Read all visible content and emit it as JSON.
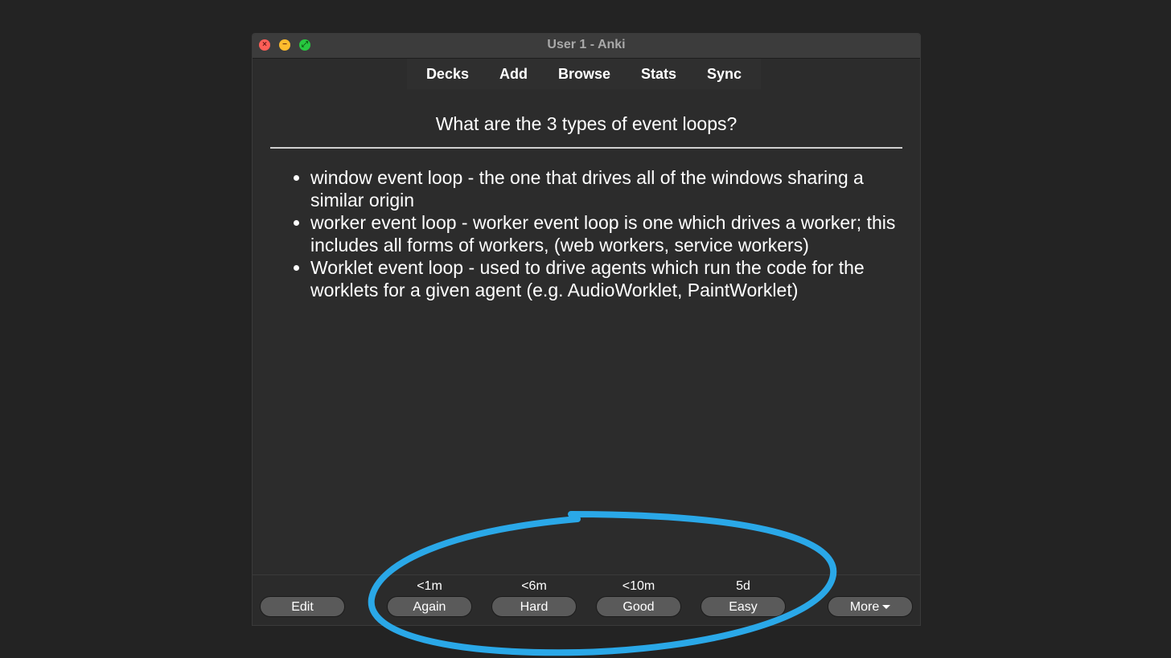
{
  "window": {
    "title": "User 1 - Anki"
  },
  "toolbar": {
    "items": [
      "Decks",
      "Add",
      "Browse",
      "Stats",
      "Sync"
    ]
  },
  "card": {
    "question": "What are the 3 types of event loops?",
    "answers": [
      "window event loop - the one that drives all of the windows sharing a similar origin",
      "worker event loop - worker event loop is one which drives a worker; this includes all forms of workers, (web workers, service workers)",
      "Worklet event loop - used to drive agents which run the code for the worklets for a given agent (e.g. AudioWorklet, PaintWorklet)"
    ]
  },
  "bottombar": {
    "edit_label": "Edit",
    "more_label": "More",
    "answer_buttons": [
      {
        "interval": "<1m",
        "label": "Again"
      },
      {
        "interval": "<6m",
        "label": "Hard"
      },
      {
        "interval": "<10m",
        "label": "Good"
      },
      {
        "interval": "5d",
        "label": "Easy"
      }
    ]
  },
  "colors": {
    "background": "#232323",
    "window": "#2c2c2c",
    "button": "#5a5a5a",
    "annotation": "#2aa8e8"
  },
  "icons": {
    "close": "close-icon",
    "minimize": "minimize-icon",
    "zoom": "zoom-icon",
    "more_caret": "chevron-down-icon"
  }
}
